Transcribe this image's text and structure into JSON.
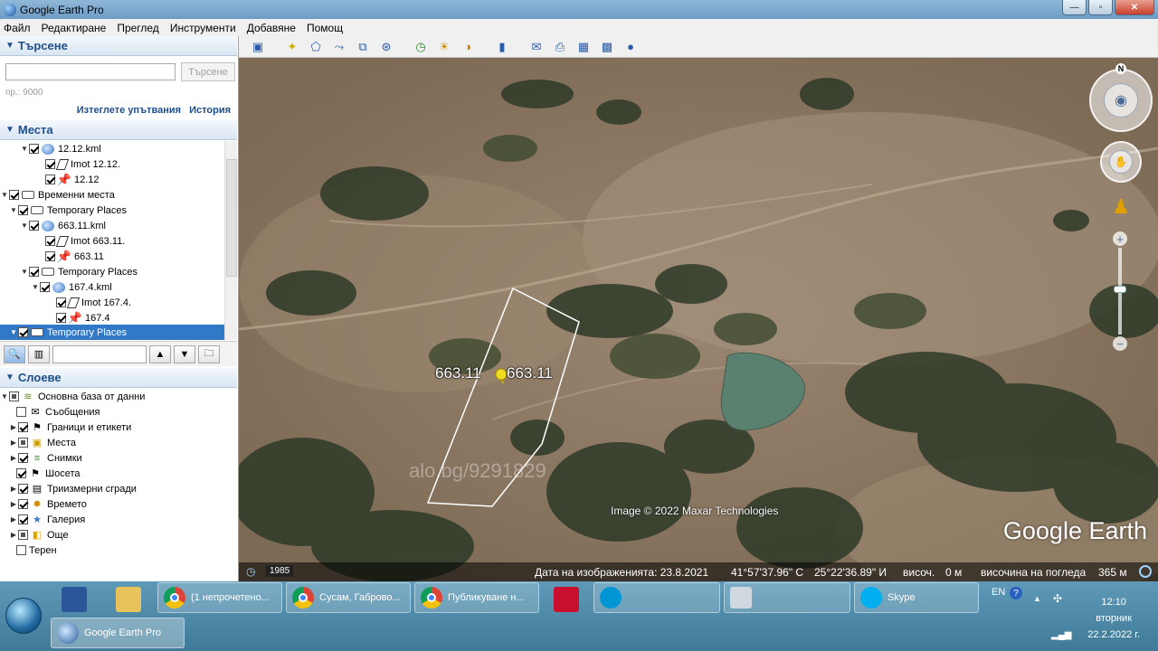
{
  "window": {
    "title": "Google Earth Pro",
    "buttons": {
      "minimize": "—",
      "maximize": "▫",
      "close": "✕"
    }
  },
  "menu": [
    "Файл",
    "Редактиране",
    "Преглед",
    "Инструменти",
    "Добавяне",
    "Помощ"
  ],
  "search": {
    "header": "Търсене",
    "button": "Търсене",
    "hint": "пр.: 9000",
    "clear_link": "Изтеглете упътвания",
    "history_link": "История"
  },
  "places": {
    "header": "Места",
    "items": [
      {
        "label": "12.12.kml"
      },
      {
        "label": "Imot 12.12."
      },
      {
        "label": "12.12"
      },
      {
        "label": "Временни места"
      },
      {
        "label": "Temporary Places"
      },
      {
        "label": "663.11.kml"
      },
      {
        "label": "Imot 663.11."
      },
      {
        "label": "663.11"
      },
      {
        "label": "Temporary Places"
      },
      {
        "label": "167.4.kml"
      },
      {
        "label": "Imot 167.4."
      },
      {
        "label": "167.4"
      },
      {
        "label": "Temporary Places"
      }
    ]
  },
  "layers": {
    "header": "Слоеве",
    "items": [
      {
        "label": "Основна база от данни"
      },
      {
        "label": "Съобщения"
      },
      {
        "label": "Граници и етикети"
      },
      {
        "label": "Места"
      },
      {
        "label": "Снимки"
      },
      {
        "label": "Шосета"
      },
      {
        "label": "Триизмерни сгради"
      },
      {
        "label": "Времето"
      },
      {
        "label": "Галерия"
      },
      {
        "label": "Още"
      },
      {
        "label": "Терен"
      }
    ]
  },
  "map": {
    "pin_label_left": "663.11",
    "pin_label_right": "663.11",
    "copyright": "Image © 2022 Maxar Technologies",
    "watermark": "alo.bg/9291829",
    "logo": "Google Earth",
    "compass_n": "N"
  },
  "status": {
    "year": "1985",
    "imagery_date": "Дата на изображенията: 23.8.2021",
    "lat": "41°57'37.96\" С",
    "lon": "25°22'36.89\" И",
    "elev_label": "височ.",
    "elev_value": "0 м",
    "eye_label": "височина на погледа",
    "eye_value": "365 м"
  },
  "taskbar": {
    "tasks": [
      {
        "label": "(1 непрочетено..."
      },
      {
        "label": "Сусам, Габрово..."
      },
      {
        "label": "Публикуване н..."
      },
      {
        "label": "Skype"
      },
      {
        "label": "Google Earth Pro"
      }
    ],
    "tray": {
      "lang": "EN",
      "time": "12:10",
      "day": "вторник",
      "date": "22.2.2022 г."
    }
  }
}
